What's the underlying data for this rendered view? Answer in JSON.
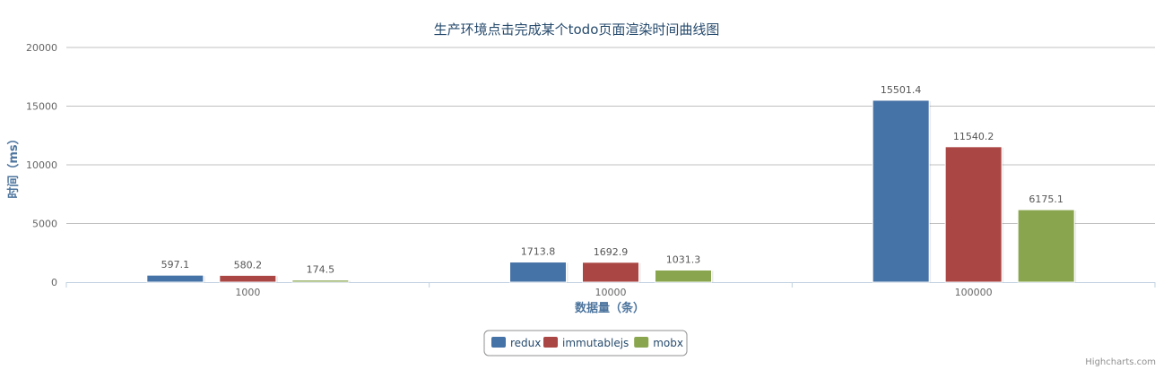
{
  "chart_data": {
    "type": "bar",
    "title": "生产环境点击完成某个todo页面渲染时间曲线图",
    "xlabel": "数据量（条）",
    "ylabel": "时间（ms）",
    "categories": [
      "1000",
      "10000",
      "100000"
    ],
    "ylim": [
      0,
      20000
    ],
    "yticks": [
      "0",
      "5000",
      "10000",
      "15000",
      "20000"
    ],
    "grid": true,
    "legend_position": "bottom-center",
    "series": [
      {
        "name": "redux",
        "color": "#4572A7",
        "values": [
          597.1,
          1713.8,
          15501.4
        ],
        "labels": [
          "597.1",
          "1713.8",
          "15501.4"
        ]
      },
      {
        "name": "immutablejs",
        "color": "#AA4643",
        "values": [
          580.2,
          1692.9,
          11540.2
        ],
        "labels": [
          "580.2",
          "1692.9",
          "11540.2"
        ]
      },
      {
        "name": "mobx",
        "color": "#89A54E",
        "values": [
          174.5,
          1031.3,
          6175.1
        ],
        "labels": [
          "174.5",
          "1031.3",
          "6175.1"
        ]
      }
    ]
  },
  "credits": "Highcharts.com"
}
